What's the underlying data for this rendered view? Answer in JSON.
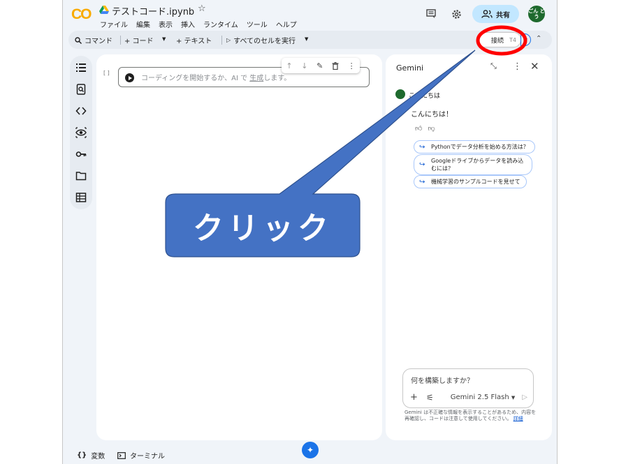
{
  "app": {
    "logo": "CO",
    "notebook_title": "テストコード.ipynb"
  },
  "menu": [
    "ファイル",
    "編集",
    "表示",
    "挿入",
    "ランタイム",
    "ツール",
    "ヘルプ"
  ],
  "header": {
    "share_label": "共有",
    "avatar_text": "ごん どう"
  },
  "toolbar": {
    "command": "コマンド",
    "code": "+ コード",
    "text": "+ テキスト",
    "run_all": "すべてのセルを実行",
    "connect": "接続",
    "connect_suffix": "T4"
  },
  "cell": {
    "bracket": "[ ]",
    "placeholder_prefix": "コーディングを開始するか、AI で",
    "placeholder_link": "生成",
    "placeholder_suffix": "します。"
  },
  "gemini": {
    "title": "Gemini",
    "user_message": "こんにちは",
    "reply": "こんにちは！",
    "suggestions": [
      "Pythonでデータ分析を始める方法は？",
      "Googleドライブからデータを読み込むには？",
      "機械学習のサンプルコードを見せて"
    ],
    "input_placeholder": "何を構築しますか？",
    "model": "Gemini 2.5 Flash",
    "disclaimer": "Gemini は不正確な情報を表示することがあるため、内容を再確認し、コードは注意して使用してください。",
    "disclaimer_link": "詳細"
  },
  "bottom": {
    "variables": "変数",
    "terminal": "ターミナル"
  },
  "annotation": {
    "callout": "クリック",
    "callout_color": "#4472c4",
    "circle_color": "#ff0000"
  },
  "colors": {
    "accent": "#1a73e8",
    "share_bg": "#c2e7ff",
    "frame_bg": "#f0f4f9"
  }
}
